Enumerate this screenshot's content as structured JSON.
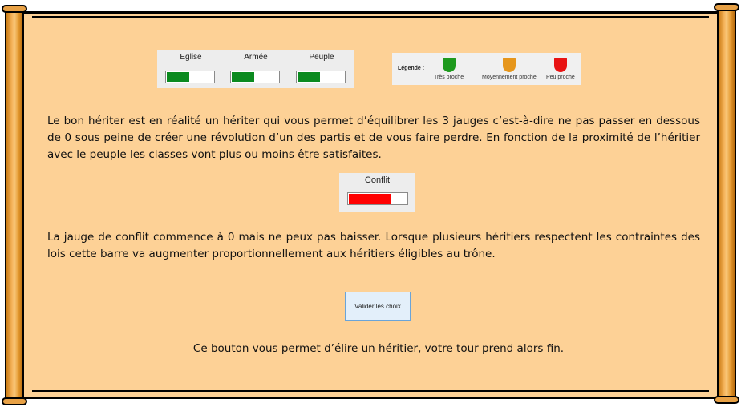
{
  "gauges": [
    {
      "label": "Eglise",
      "level": 0.48,
      "color": "#0b8a1f"
    },
    {
      "label": "Armée",
      "level": 0.48,
      "color": "#0b8a1f"
    },
    {
      "label": "Peuple",
      "level": 0.48,
      "color": "#0b8a1f"
    }
  ],
  "legend": {
    "title": "Légende :",
    "items": [
      {
        "label": "Très proche",
        "color": "#1e9a1e",
        "icon": "green-shield-icon"
      },
      {
        "label": "Moyennement proche",
        "color": "#e6961c",
        "icon": "orange-shield-icon"
      },
      {
        "label": "Peu proche",
        "color": "#e81313",
        "icon": "red-shield-icon"
      }
    ]
  },
  "paragraphs": {
    "p1": "Le bon hériter est en réalité un hériter qui vous permet d’équilibrer les 3 jauges c’est-à-dire ne pas passer en dessous de 0 sous peine de créer une révolution d’un des partis et de vous faire perdre. En fonction de la proximité de l’héritier avec le peuple les classes vont plus ou moins être satisfaites.",
    "p2": "La jauge de conflit commence à 0 mais ne peux pas baisser. Lorsque plusieurs héritiers respectent les contraintes des lois cette barre va augmenter proportionnellement aux héritiers éligibles au trône.",
    "p3": "Ce bouton vous permet d’élire un héritier, votre tour prend alors fin."
  },
  "conflict": {
    "label": "Conflit",
    "level": 0.72,
    "color": "#ff0000"
  },
  "button": {
    "label": "Valider les choix"
  }
}
